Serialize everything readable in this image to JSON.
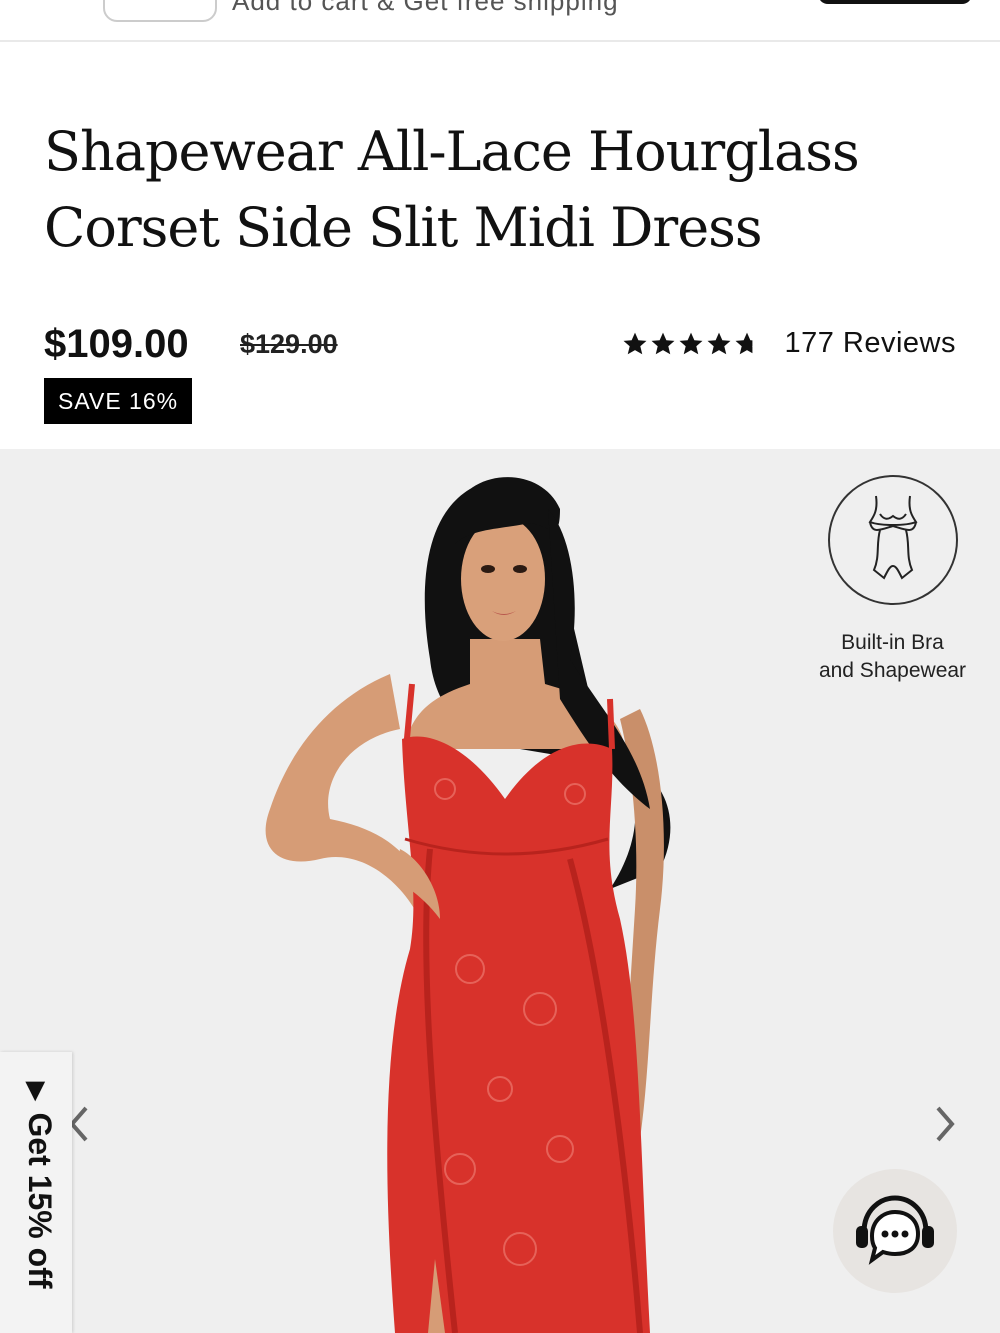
{
  "header": {
    "partial_text": "Add to cart & Get free shipping"
  },
  "product": {
    "title": "Shapewear All-Lace Hourglass Corset Side Slit Midi Dress",
    "price": "$109.00",
    "compare_price": "$129.00",
    "save_badge": "SAVE 16%",
    "rating_value": 4.7,
    "reviews": "177 Reviews"
  },
  "gallery": {
    "feature_label_line1": "Built-in Bra",
    "feature_label_line2": "and Shapewear",
    "feature_icon": "bodysuit-icon",
    "prev_icon": "chevron-left-icon",
    "next_icon": "chevron-right-icon",
    "chat_icon": "headset-chat-icon"
  },
  "side_tab": {
    "arrow": "▶",
    "label": "Get 15% off"
  },
  "colors": {
    "accent": "#000000",
    "dress_red": "#d8322b",
    "background": "#efefef"
  }
}
